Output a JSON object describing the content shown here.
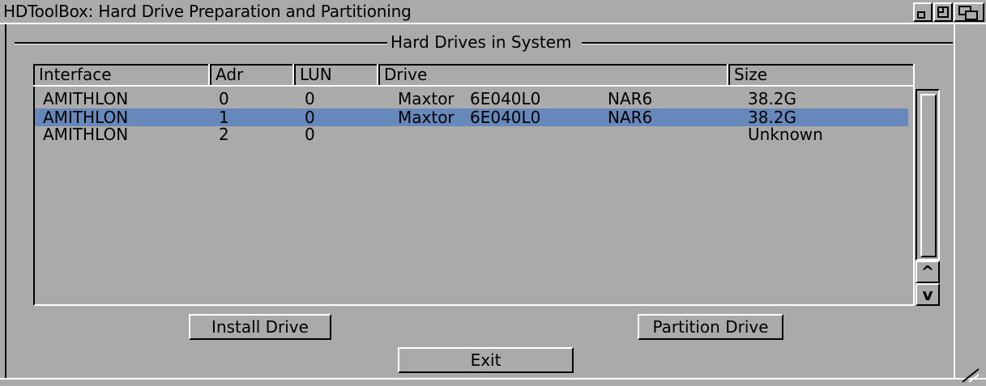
{
  "window": {
    "title": "HDToolBox: Hard Drive Preparation and Partitioning"
  },
  "group": {
    "title": "Hard Drives in System"
  },
  "table": {
    "columns": [
      "Interface",
      "Adr",
      "LUN",
      "Drive",
      "Size"
    ],
    "rows": [
      {
        "interface": "AMITHLON",
        "adr": "0",
        "lun": "0",
        "vendor": "Maxtor",
        "model": "6E040L0",
        "rev": "NAR6",
        "size": "38.2G",
        "selected": false
      },
      {
        "interface": "AMITHLON",
        "adr": "1",
        "lun": "0",
        "vendor": "Maxtor",
        "model": "6E040L0",
        "rev": "NAR6",
        "size": "38.2G",
        "selected": true
      },
      {
        "interface": "AMITHLON",
        "adr": "2",
        "lun": "0",
        "vendor": "",
        "model": "",
        "rev": "",
        "size": "Unknown",
        "selected": false
      }
    ]
  },
  "scrollbar": {
    "up_glyph": "^",
    "down_glyph": "v"
  },
  "buttons": {
    "install": "Install Drive",
    "partition": "Partition Drive",
    "exit": "Exit"
  },
  "colors": {
    "background": "#aaaaaa",
    "selection": "#6688bb"
  },
  "icons": [
    "zoom-gadget-icon",
    "depth-gadget-icon",
    "resize-gadget-icon",
    "scroll-up-icon",
    "scroll-down-icon"
  ]
}
